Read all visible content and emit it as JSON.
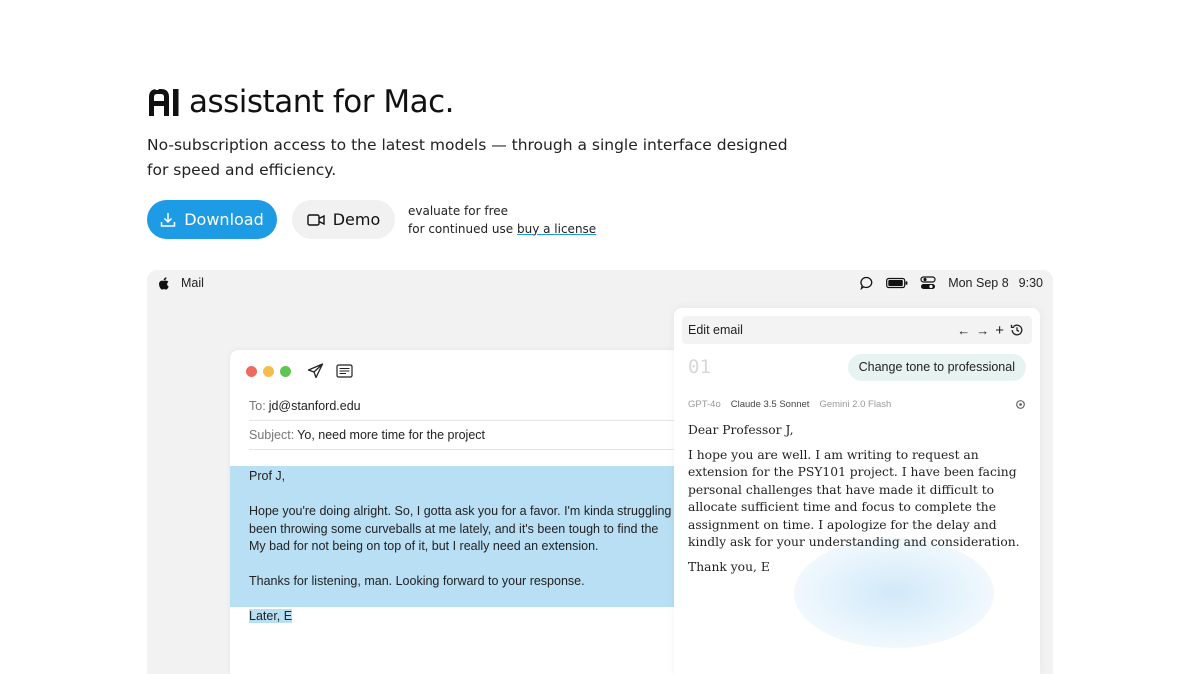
{
  "hero": {
    "logo_icon": "ai-logo-mark",
    "headline": "assistant for Mac.",
    "subheadline": "No-subscription access to the latest models — through a single interface designed for speed and efficiency."
  },
  "cta": {
    "download_label": "Download",
    "download_icon": "download-icon",
    "demo_label": "Demo",
    "demo_icon": "video-camera-icon",
    "eval_line1": "evaluate for free",
    "eval_line2_prefix": "for continued use ",
    "eval_link": "buy a license",
    "accent_color": "#1d9be4"
  },
  "menubar": {
    "app_name": "Mail",
    "date": "Mon Sep 8",
    "time": "9:30",
    "icons": [
      "apple-icon",
      "chat-bubble-icon",
      "battery-icon",
      "control-center-icon"
    ]
  },
  "mail": {
    "to_label": "To:",
    "to_value": "jd@stanford.edu",
    "subject_label": "Subject:",
    "subject_value": "Yo, need more time for the project",
    "body": [
      "Prof J,",
      "Hope you're doing alright. So, I gotta ask you for a favor. I'm kinda struggling",
      "been throwing some curveballs at me lately, and it's been tough to find the",
      "My bad for not being on top of it, but I really need an extension.",
      "Thanks for listening, man. Looking forward to your response.",
      "Later, E"
    ],
    "selection_color": "#b8dff4"
  },
  "panel": {
    "title": "Edit email",
    "counter": "01",
    "prompt": "Change tone to professional",
    "models": [
      "GPT-4o",
      "Claude 3.5 Sonnet",
      "Gemini 2.0 Flash"
    ],
    "reply": {
      "greeting": "Dear Professor J,",
      "paragraph": "I hope you are well. I am writing to request an extension for the PSY101 project. I have been facing personal challenges that have made it difficult to allocate sufficient time and focus to complete the assignment on time. I apologize for the delay and kindly ask for your understanding and consideration.",
      "signoff": "Thank you, E"
    }
  }
}
